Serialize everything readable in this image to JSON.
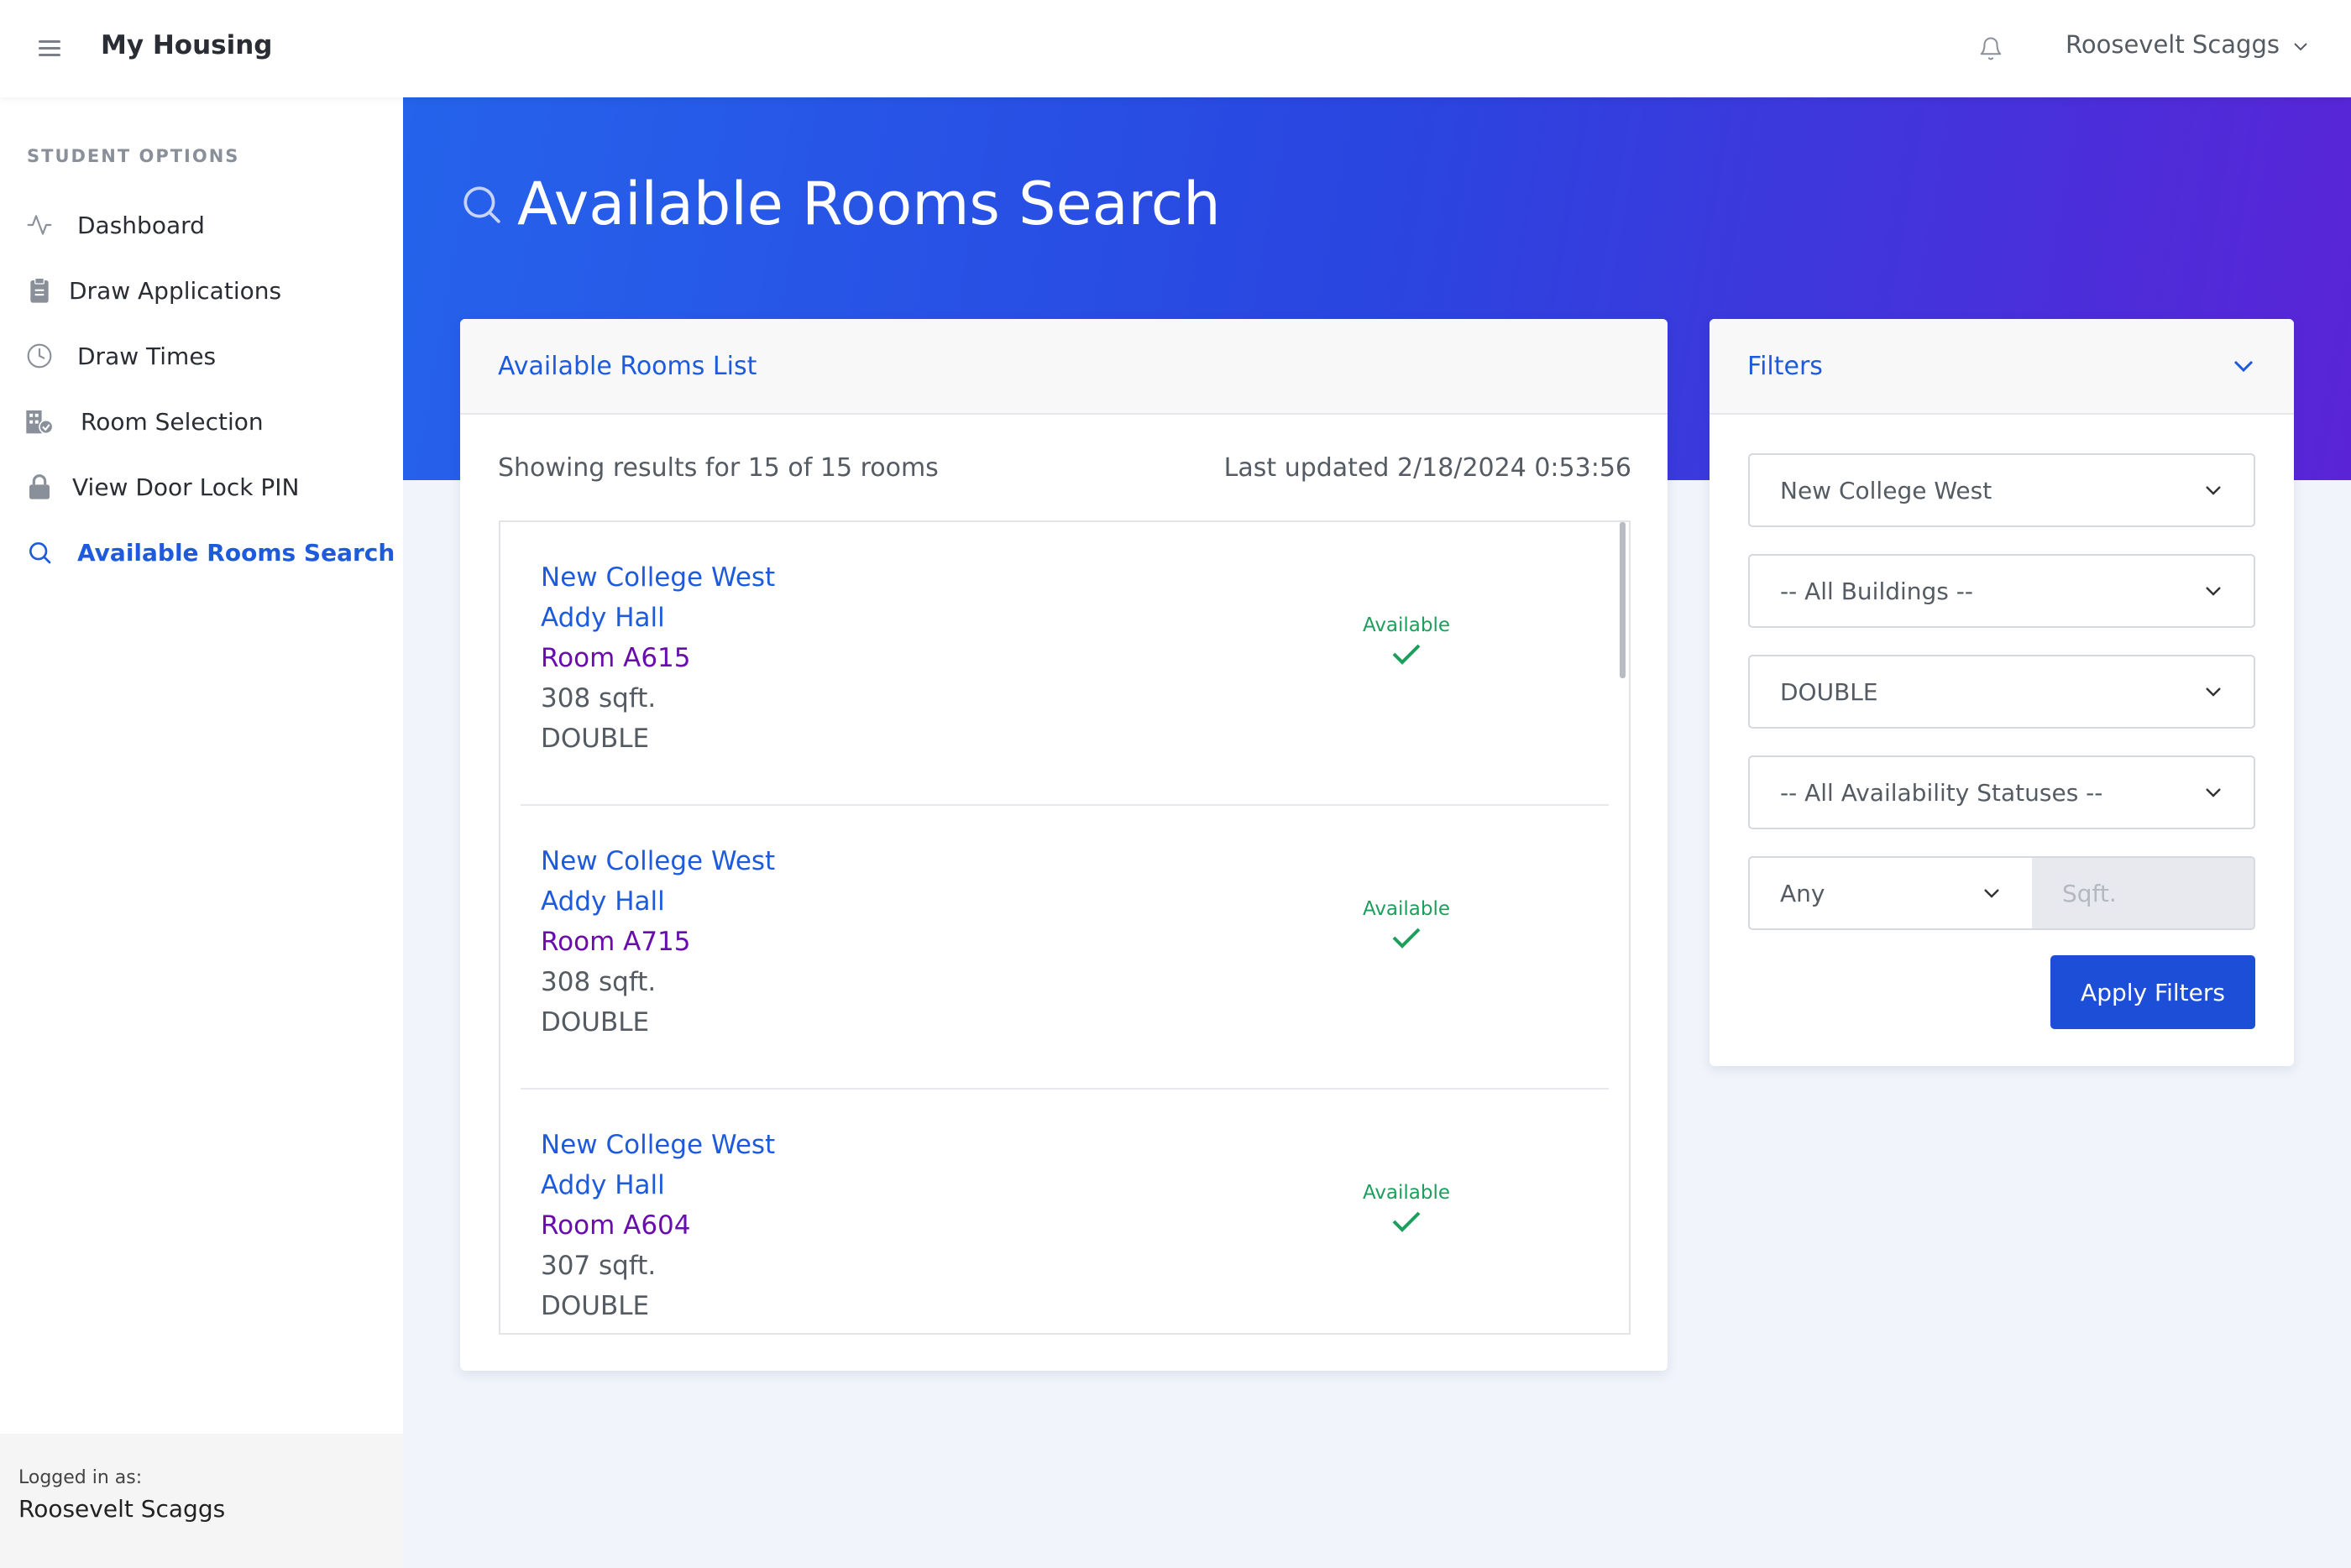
{
  "app": {
    "title": "My Housing",
    "user_name": "Roosevelt Scaggs"
  },
  "topbar": {
    "menu_icon": "hamburger-icon",
    "bell_icon": "bell-icon",
    "dropdown_icon": "chevron-down-icon"
  },
  "sidebar": {
    "heading": "STUDENT OPTIONS",
    "items": [
      {
        "label": "Dashboard",
        "icon": "activity-icon"
      },
      {
        "label": "Draw Applications",
        "icon": "clipboard-icon"
      },
      {
        "label": "Draw Times",
        "icon": "clock-icon"
      },
      {
        "label": "Room Selection",
        "icon": "building-check-icon"
      },
      {
        "label": "View Door Lock PIN",
        "icon": "lock-icon"
      },
      {
        "label": "Available Rooms Search",
        "icon": "search-icon",
        "active": true
      }
    ],
    "footer": {
      "label": "Logged in as:",
      "name": "Roosevelt Scaggs"
    }
  },
  "hero": {
    "title": "Available Rooms Search",
    "icon": "search-icon"
  },
  "rooms_card": {
    "title": "Available Rooms List",
    "results_text": "Showing results for 15 of 15 rooms",
    "last_updated": "Last updated 2/18/2024 0:53:56",
    "rooms": [
      {
        "campus": "New College West",
        "building": "Addy Hall",
        "room": "Room A615",
        "sqft": "308 sqft.",
        "type": "DOUBLE",
        "status": "Available"
      },
      {
        "campus": "New College West",
        "building": "Addy Hall",
        "room": "Room A715",
        "sqft": "308 sqft.",
        "type": "DOUBLE",
        "status": "Available"
      },
      {
        "campus": "New College West",
        "building": "Addy Hall",
        "room": "Room A604",
        "sqft": "307 sqft.",
        "type": "DOUBLE",
        "status": "Available"
      }
    ]
  },
  "filters": {
    "title": "Filters",
    "campus": "New College West",
    "building": "-- All Buildings --",
    "room_type": "DOUBLE",
    "availability": "-- All Availability Statuses --",
    "sqft_operator": "Any",
    "sqft_placeholder": "Sqft.",
    "apply_label": "Apply Filters"
  },
  "colors": {
    "accent": "#1d5bdc",
    "room_number": "#6a0dad",
    "available": "#1e9e5c",
    "hero_start": "#2563eb",
    "hero_end": "#5a24d6",
    "button": "#1d4ed8"
  }
}
